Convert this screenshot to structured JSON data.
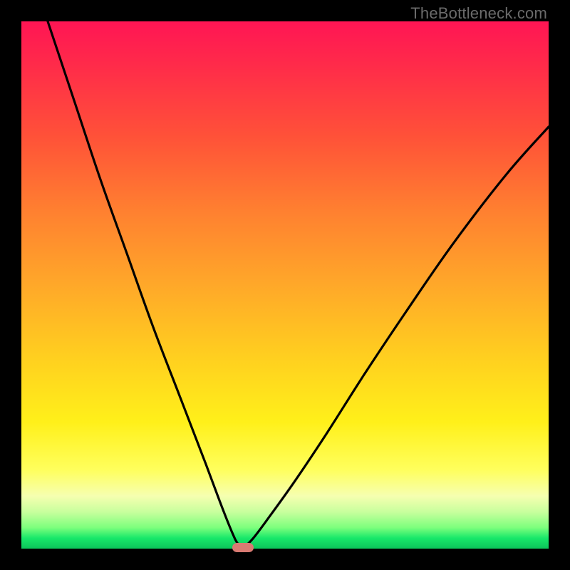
{
  "watermark": "TheBottleneck.com",
  "chart_data": {
    "type": "line",
    "title": "",
    "xlabel": "",
    "ylabel": "",
    "xlim": [
      0,
      100
    ],
    "ylim": [
      0,
      100
    ],
    "series": [
      {
        "name": "left-branch",
        "x": [
          5,
          10,
          15,
          20,
          25,
          30,
          35,
          38,
          40,
          41,
          42
        ],
        "values": [
          100,
          85,
          70,
          56,
          42,
          29,
          16,
          8,
          3,
          1,
          0
        ]
      },
      {
        "name": "right-branch",
        "x": [
          42,
          44,
          47,
          52,
          58,
          65,
          73,
          82,
          92,
          100
        ],
        "values": [
          0,
          2,
          6,
          13,
          22,
          33,
          45,
          58,
          71,
          80
        ]
      }
    ],
    "marker": {
      "x": 42,
      "y": 0,
      "color": "#d97a72"
    },
    "gradient_stops": [
      {
        "pos": 0,
        "color": "#ff1554"
      },
      {
        "pos": 22,
        "color": "#ff5238"
      },
      {
        "pos": 50,
        "color": "#ffa829"
      },
      {
        "pos": 76,
        "color": "#fff01a"
      },
      {
        "pos": 93,
        "color": "#c9ff9e"
      },
      {
        "pos": 100,
        "color": "#0cc45a"
      }
    ]
  }
}
